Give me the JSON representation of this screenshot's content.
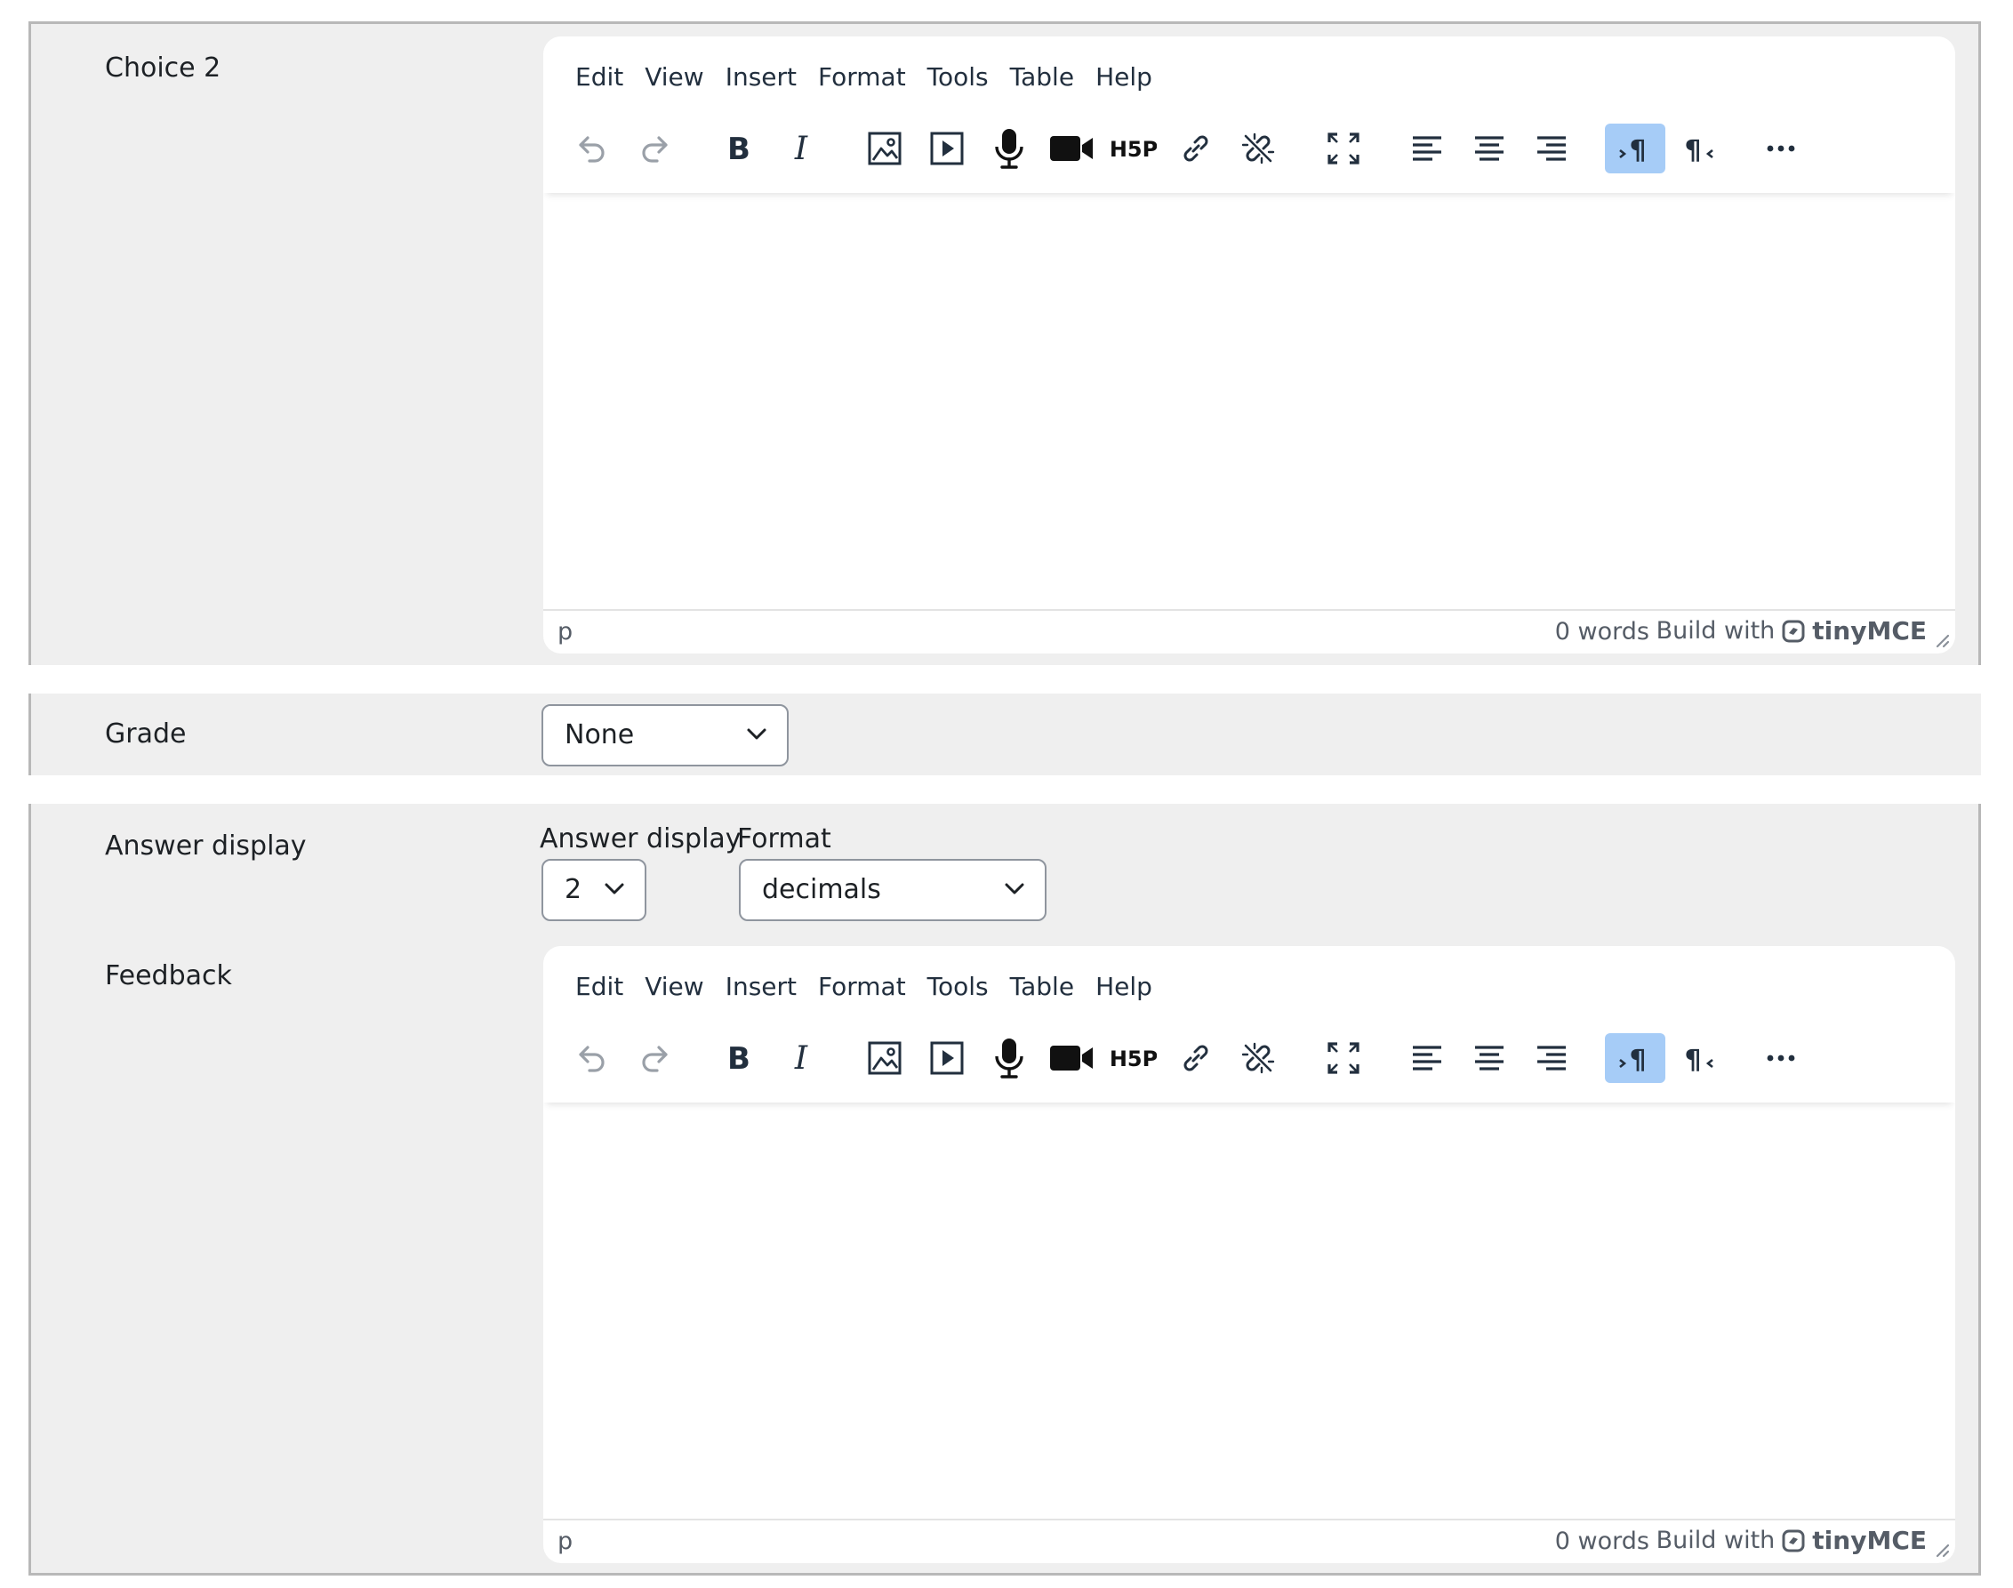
{
  "choice": {
    "label": "Choice 2",
    "editor": {
      "menu": [
        "Edit",
        "View",
        "Insert",
        "Format",
        "Tools",
        "Table",
        "Help"
      ],
      "status_path": "p",
      "word_count": "0 words",
      "brand_prefix": "Build with",
      "brand_name": "tinyMCE"
    }
  },
  "grade": {
    "label": "Grade",
    "value": "None"
  },
  "answer_display": {
    "label": "Answer display",
    "sublabel_left": "Answer display",
    "sublabel_right": "Format",
    "digits_value": "2",
    "format_value": "decimals"
  },
  "feedback": {
    "label": "Feedback",
    "editor": {
      "menu": [
        "Edit",
        "View",
        "Insert",
        "Format",
        "Tools",
        "Table",
        "Help"
      ],
      "status_path": "p",
      "word_count": "0 words",
      "brand_prefix": "Build with",
      "brand_name": "tinyMCE"
    }
  },
  "toolbar_icons": [
    "undo-icon",
    "redo-icon",
    "bold-icon",
    "italic-icon",
    "image-icon",
    "media-icon",
    "microphone-icon",
    "video-camera-icon",
    "h5p-icon",
    "link-icon",
    "unlink-icon",
    "fullscreen-icon",
    "align-left-icon",
    "align-center-icon",
    "align-right-icon",
    "ltr-icon",
    "rtl-icon",
    "more-icon"
  ],
  "colors": {
    "panel_bg": "#efefef",
    "active_button": "#a6ccf7",
    "text": "#1d2125"
  }
}
